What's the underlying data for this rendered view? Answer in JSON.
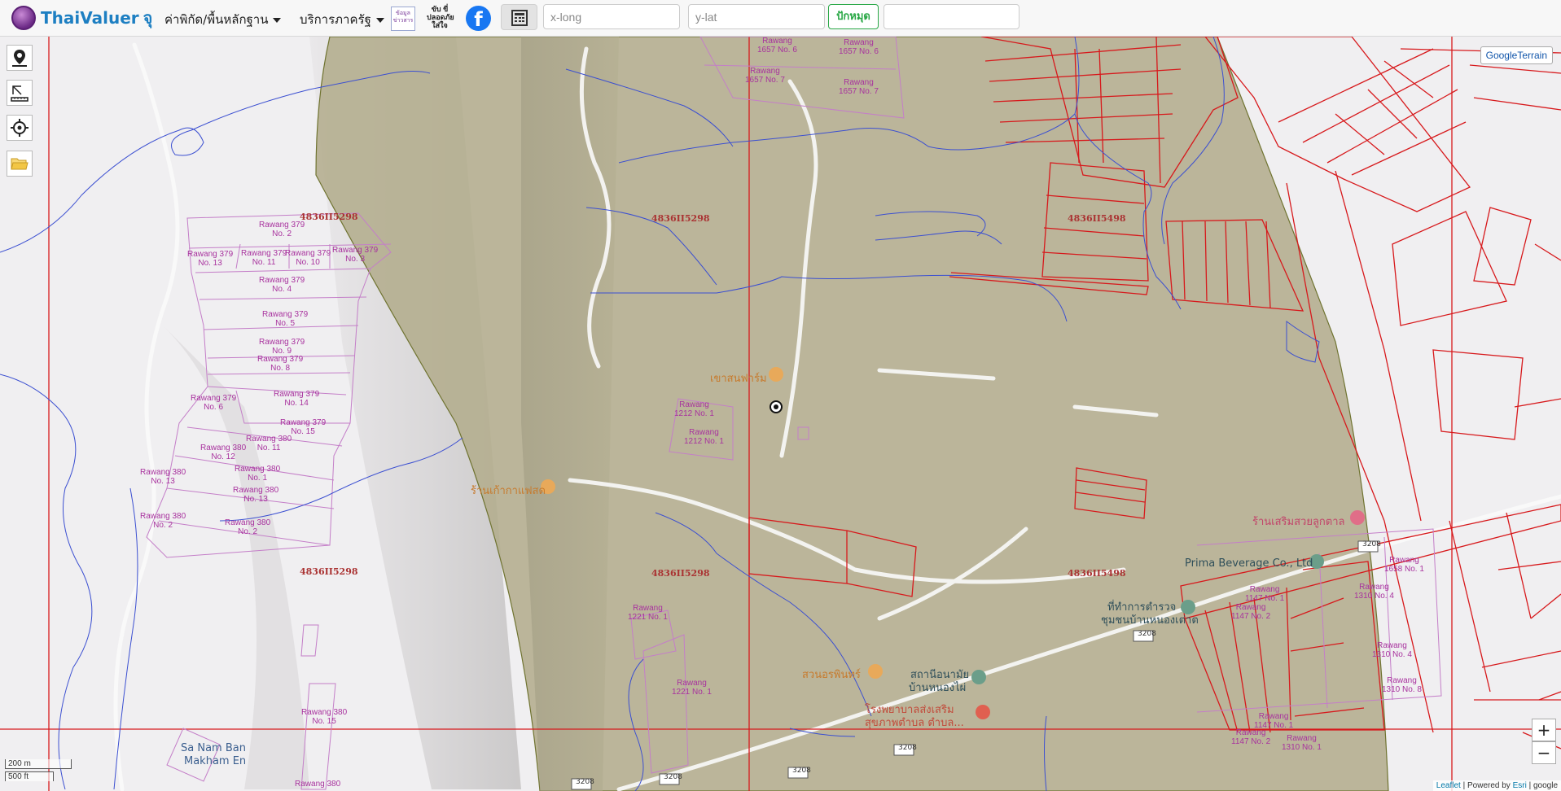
{
  "header": {
    "brand_name": "ThaiValuer",
    "brand_suffix": "จุ",
    "menu_price": "ค่าพิกัด/พื้นหลักฐาน",
    "menu_services": "บริการภาครัฐ",
    "logo1_text": "ข้อมูลข่าวสาร",
    "logo2_text": "ขับ ขี่ปลอดภัย ใส่ใจ",
    "facebook_glyph": "f",
    "x_placeholder": "x-long",
    "y_placeholder": "y-lat",
    "pin_button": "ปักหมุด",
    "extra_value": ""
  },
  "map": {
    "terrain_button": "GoogleTerrain",
    "zoom_in": "+",
    "zoom_out": "−",
    "scale_m": "200 m",
    "scale_ft": "500 ft",
    "attribution_leaflet": "Leaflet",
    "attribution_rest": "| Powered by",
    "attribution_esri": "Esri",
    "attribution_google": "| google",
    "sheet_labels": [
      "4836II5298",
      "4836II5298",
      "4836II5498",
      "4836II5298",
      "4836II5298",
      "4836II5498"
    ],
    "parcel_labels": [
      "Rawang",
      "1657 No. 6",
      "Rawang",
      "1657 No. 6",
      "Rawang",
      "1657 No. 7",
      "Rawang",
      "1657 No. 7",
      "Rawang 379",
      "No. 2",
      "Rawang 379",
      "No. 13",
      "Rawang 379",
      "No. 11",
      "Rawang 379",
      "No. 10",
      "Rawang 379",
      "No. 3",
      "Rawang 379",
      "No. 4",
      "Rawang 379",
      "No. 5",
      "Rawang 379",
      "No. 9",
      "Rawang 379",
      "No. 8",
      "Rawang 379",
      "No. 6",
      "Rawang 379",
      "No. 14",
      "Rawang 379",
      "No. 15",
      "Rawang 380",
      "No. 11",
      "Rawang 380",
      "No. 12",
      "Rawang 380",
      "No. 13",
      "Rawang 380",
      "No. 1",
      "Rawang 380",
      "No. 13",
      "Rawang 380",
      "No. 2",
      "Rawang 380",
      "No. 2",
      "Rawang 380",
      "No. 15",
      "Rawang 380",
      "Rawang",
      "1212 No. 1",
      "Rawang",
      "1212 No. 1",
      "Rawang",
      "1221 No. 1",
      "Rawang",
      "1221 No. 1",
      "Rawang",
      "1147 No. 1",
      "Rawang",
      "1147 No. 2",
      "Rawang",
      "1147 No. 1",
      "Rawang",
      "1147 No. 2",
      "Rawang",
      "1310 No. 1",
      "Rawang",
      "1658 No. 1",
      "Rawang",
      "1310 No. 4",
      "Rawang",
      "1310 No. 4",
      "Rawang",
      "1310 No. 8"
    ],
    "pois": {
      "farm": "เขาสนฟาร์ม",
      "cafe": "ร้านเก้ากาแฟสด",
      "garden": "สวนอรพินทร์",
      "restaurant": "ร้านเสริมสวยลูกตาล",
      "company": "Prima Beverage Co., Ltd",
      "police_1": "ที่ทำการตำรวจ",
      "police_2": "ชุมชนบ้านหนองเต่าต",
      "station_1": "สถานีอนามัย",
      "station_2": "บ้านหนองไผ่",
      "hospital_1": "โรงพยาบาลส่งเสริม",
      "hospital_2": "สุขภาพตำบล ตำบล...",
      "village_1": "Sa Nam Ban",
      "village_2": "Makham En",
      "road_3208": "3208"
    },
    "colors": {
      "parcel_red": "#d7191c",
      "parcel_purple": "#c47ec8",
      "zone_fill": "#b3ad8d",
      "river_blue": "#3b4fd1"
    }
  }
}
